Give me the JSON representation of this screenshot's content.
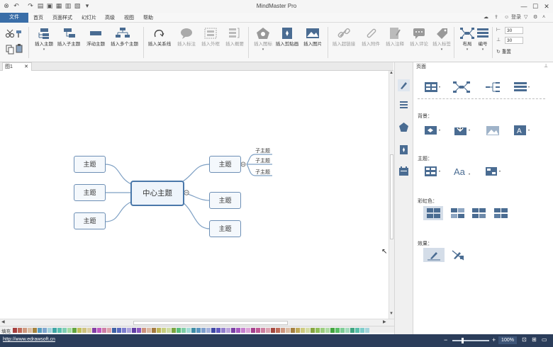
{
  "window": {
    "title": "MindMaster Pro"
  },
  "menu": {
    "file": "文件",
    "items": [
      "首页",
      "页面样式",
      "幻灯片",
      "高级",
      "视图",
      "帮助"
    ],
    "login": "登录"
  },
  "ribbon": {
    "buttons": [
      {
        "label": "插入主题",
        "disabled": false
      },
      {
        "label": "插入子主题",
        "disabled": false
      },
      {
        "label": "浮动主题",
        "disabled": false
      },
      {
        "label": "插入多个主题",
        "disabled": false
      },
      {
        "label": "插入关系线",
        "disabled": false
      },
      {
        "label": "插入标注",
        "disabled": true
      },
      {
        "label": "插入外框",
        "disabled": true
      },
      {
        "label": "插入概要",
        "disabled": true
      },
      {
        "label": "插入图标",
        "disabled": true
      },
      {
        "label": "插入剪贴画",
        "disabled": false
      },
      {
        "label": "插入图片",
        "disabled": false
      },
      {
        "label": "插入超链接",
        "disabled": true
      },
      {
        "label": "插入附件",
        "disabled": true
      },
      {
        "label": "插入注释",
        "disabled": true
      },
      {
        "label": "插入评论",
        "disabled": true
      },
      {
        "label": "插入标签",
        "disabled": true
      },
      {
        "label": "布局",
        "disabled": false
      },
      {
        "label": "编号",
        "disabled": false
      }
    ],
    "spin1": "30",
    "spin2": "30",
    "reset": "重置"
  },
  "doc": {
    "tab": "图1"
  },
  "mindmap": {
    "central": "中心主题",
    "left": [
      "主题",
      "主题",
      "主题"
    ],
    "right": [
      "主题",
      "主题",
      "主题"
    ],
    "subs": [
      "子主题",
      "子主题",
      "子主题"
    ]
  },
  "panel": {
    "title": "页面",
    "bg_label": "背景：",
    "topic_label": "主题：",
    "rainbow_label": "彩虹色：",
    "effect_label": "效果："
  },
  "palette": {
    "label": "填充"
  },
  "status": {
    "url": "http://www.edrawsoft.cn",
    "zoom": "100%"
  },
  "colors": {
    "accent": "#3a6ea8",
    "topic_border": "#6d8fb5",
    "status_bg": "#2b3d5a"
  }
}
